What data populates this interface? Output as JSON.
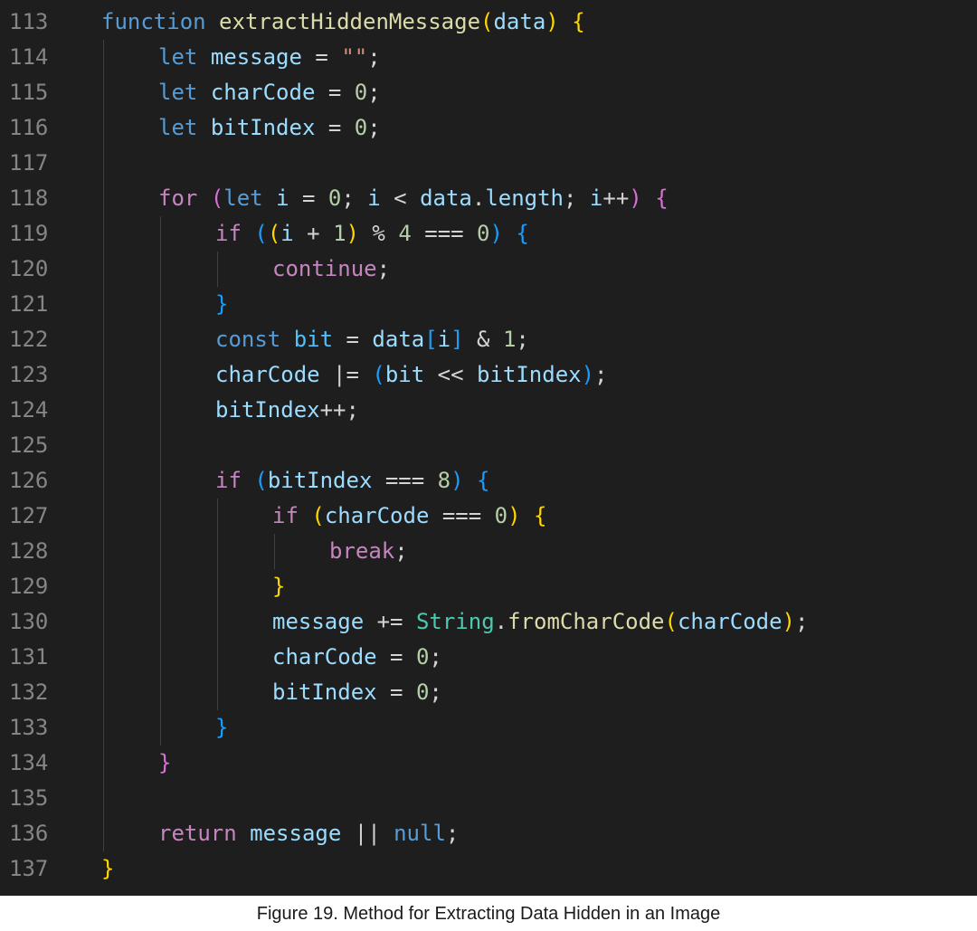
{
  "caption": "Figure 19. Method for Extracting Data Hidden in an Image",
  "colors": {
    "background": "#1e1e1e",
    "line_number": "#858585",
    "keyword": "#569cd6",
    "control_keyword": "#c586c0",
    "function": "#dcdcaa",
    "variable": "#9cdcfe",
    "number": "#b5cea8",
    "string": "#ce9178",
    "bracket_level1": "#ffd700",
    "bracket_level2": "#da70d6",
    "bracket_level3": "#179fff"
  },
  "lines": [
    {
      "n": "113",
      "indent": 0,
      "tokens": [
        [
          "kw",
          "function"
        ],
        [
          "op",
          " "
        ],
        [
          "fn",
          "extractHiddenMessage"
        ],
        [
          "b1",
          "("
        ],
        [
          "var",
          "data"
        ],
        [
          "b1",
          ")"
        ],
        [
          "op",
          " "
        ],
        [
          "b1",
          "{"
        ]
      ]
    },
    {
      "n": "114",
      "indent": 1,
      "tokens": [
        [
          "kw",
          "let"
        ],
        [
          "op",
          " "
        ],
        [
          "var",
          "message"
        ],
        [
          "op",
          " = "
        ],
        [
          "str",
          "\"\""
        ],
        [
          "op",
          ";"
        ]
      ]
    },
    {
      "n": "115",
      "indent": 1,
      "tokens": [
        [
          "kw",
          "let"
        ],
        [
          "op",
          " "
        ],
        [
          "var",
          "charCode"
        ],
        [
          "op",
          " = "
        ],
        [
          "num",
          "0"
        ],
        [
          "op",
          ";"
        ]
      ]
    },
    {
      "n": "116",
      "indent": 1,
      "tokens": [
        [
          "kw",
          "let"
        ],
        [
          "op",
          " "
        ],
        [
          "var",
          "bitIndex"
        ],
        [
          "op",
          " = "
        ],
        [
          "num",
          "0"
        ],
        [
          "op",
          ";"
        ]
      ]
    },
    {
      "n": "117",
      "indent": 0,
      "tokens": []
    },
    {
      "n": "118",
      "indent": 1,
      "tokens": [
        [
          "ctl",
          "for"
        ],
        [
          "op",
          " "
        ],
        [
          "b2",
          "("
        ],
        [
          "kw",
          "let"
        ],
        [
          "op",
          " "
        ],
        [
          "var",
          "i"
        ],
        [
          "op",
          " = "
        ],
        [
          "num",
          "0"
        ],
        [
          "op",
          "; "
        ],
        [
          "var",
          "i"
        ],
        [
          "op",
          " < "
        ],
        [
          "var",
          "data"
        ],
        [
          "op",
          "."
        ],
        [
          "var",
          "length"
        ],
        [
          "op",
          "; "
        ],
        [
          "var",
          "i"
        ],
        [
          "op",
          "++"
        ],
        [
          "b2",
          ")"
        ],
        [
          "op",
          " "
        ],
        [
          "b2",
          "{"
        ]
      ]
    },
    {
      "n": "119",
      "indent": 2,
      "tokens": [
        [
          "ctl",
          "if"
        ],
        [
          "op",
          " "
        ],
        [
          "b3",
          "("
        ],
        [
          "b1",
          "("
        ],
        [
          "var",
          "i"
        ],
        [
          "op",
          " + "
        ],
        [
          "num",
          "1"
        ],
        [
          "b1",
          ")"
        ],
        [
          "op",
          " % "
        ],
        [
          "num",
          "4"
        ],
        [
          "op",
          " === "
        ],
        [
          "num",
          "0"
        ],
        [
          "b3",
          ")"
        ],
        [
          "op",
          " "
        ],
        [
          "b3",
          "{"
        ]
      ]
    },
    {
      "n": "120",
      "indent": 3,
      "tokens": [
        [
          "ctl",
          "continue"
        ],
        [
          "op",
          ";"
        ]
      ]
    },
    {
      "n": "121",
      "indent": 2,
      "tokens": [
        [
          "b3",
          "}"
        ]
      ]
    },
    {
      "n": "122",
      "indent": 2,
      "tokens": [
        [
          "kw",
          "const"
        ],
        [
          "op",
          " "
        ],
        [
          "const",
          "bit"
        ],
        [
          "op",
          " = "
        ],
        [
          "var",
          "data"
        ],
        [
          "b3",
          "["
        ],
        [
          "var",
          "i"
        ],
        [
          "b3",
          "]"
        ],
        [
          "op",
          " & "
        ],
        [
          "num",
          "1"
        ],
        [
          "op",
          ";"
        ]
      ]
    },
    {
      "n": "123",
      "indent": 2,
      "tokens": [
        [
          "var",
          "charCode"
        ],
        [
          "op",
          " |= "
        ],
        [
          "b3",
          "("
        ],
        [
          "var",
          "bit"
        ],
        [
          "op",
          " << "
        ],
        [
          "var",
          "bitIndex"
        ],
        [
          "b3",
          ")"
        ],
        [
          "op",
          ";"
        ]
      ]
    },
    {
      "n": "124",
      "indent": 2,
      "tokens": [
        [
          "var",
          "bitIndex"
        ],
        [
          "op",
          "++;"
        ]
      ]
    },
    {
      "n": "125",
      "indent": 0,
      "tokens": []
    },
    {
      "n": "126",
      "indent": 2,
      "tokens": [
        [
          "ctl",
          "if"
        ],
        [
          "op",
          " "
        ],
        [
          "b3",
          "("
        ],
        [
          "var",
          "bitIndex"
        ],
        [
          "op",
          " === "
        ],
        [
          "num",
          "8"
        ],
        [
          "b3",
          ")"
        ],
        [
          "op",
          " "
        ],
        [
          "b3",
          "{"
        ]
      ]
    },
    {
      "n": "127",
      "indent": 3,
      "tokens": [
        [
          "ctl",
          "if"
        ],
        [
          "op",
          " "
        ],
        [
          "b1",
          "("
        ],
        [
          "var",
          "charCode"
        ],
        [
          "op",
          " === "
        ],
        [
          "num",
          "0"
        ],
        [
          "b1",
          ")"
        ],
        [
          "op",
          " "
        ],
        [
          "b1",
          "{"
        ]
      ]
    },
    {
      "n": "128",
      "indent": 4,
      "tokens": [
        [
          "ctl",
          "break"
        ],
        [
          "op",
          ";"
        ]
      ]
    },
    {
      "n": "129",
      "indent": 3,
      "tokens": [
        [
          "b1",
          "}"
        ]
      ]
    },
    {
      "n": "130",
      "indent": 3,
      "tokens": [
        [
          "var",
          "message"
        ],
        [
          "op",
          " += "
        ],
        [
          "typ",
          "String"
        ],
        [
          "op",
          "."
        ],
        [
          "fn",
          "fromCharCode"
        ],
        [
          "b1",
          "("
        ],
        [
          "var",
          "charCode"
        ],
        [
          "b1",
          ")"
        ],
        [
          "op",
          ";"
        ]
      ]
    },
    {
      "n": "131",
      "indent": 3,
      "tokens": [
        [
          "var",
          "charCode"
        ],
        [
          "op",
          " = "
        ],
        [
          "num",
          "0"
        ],
        [
          "op",
          ";"
        ]
      ]
    },
    {
      "n": "132",
      "indent": 3,
      "tokens": [
        [
          "var",
          "bitIndex"
        ],
        [
          "op",
          " = "
        ],
        [
          "num",
          "0"
        ],
        [
          "op",
          ";"
        ]
      ]
    },
    {
      "n": "133",
      "indent": 2,
      "tokens": [
        [
          "b3",
          "}"
        ]
      ]
    },
    {
      "n": "134",
      "indent": 1,
      "tokens": [
        [
          "b2",
          "}"
        ]
      ]
    },
    {
      "n": "135",
      "indent": 0,
      "tokens": []
    },
    {
      "n": "136",
      "indent": 1,
      "tokens": [
        [
          "ctl",
          "return"
        ],
        [
          "op",
          " "
        ],
        [
          "var",
          "message"
        ],
        [
          "op",
          " || "
        ],
        [
          "kw",
          "null"
        ],
        [
          "op",
          ";"
        ]
      ]
    },
    {
      "n": "137",
      "indent": 0,
      "tokens": [
        [
          "b1",
          "}"
        ]
      ]
    }
  ]
}
